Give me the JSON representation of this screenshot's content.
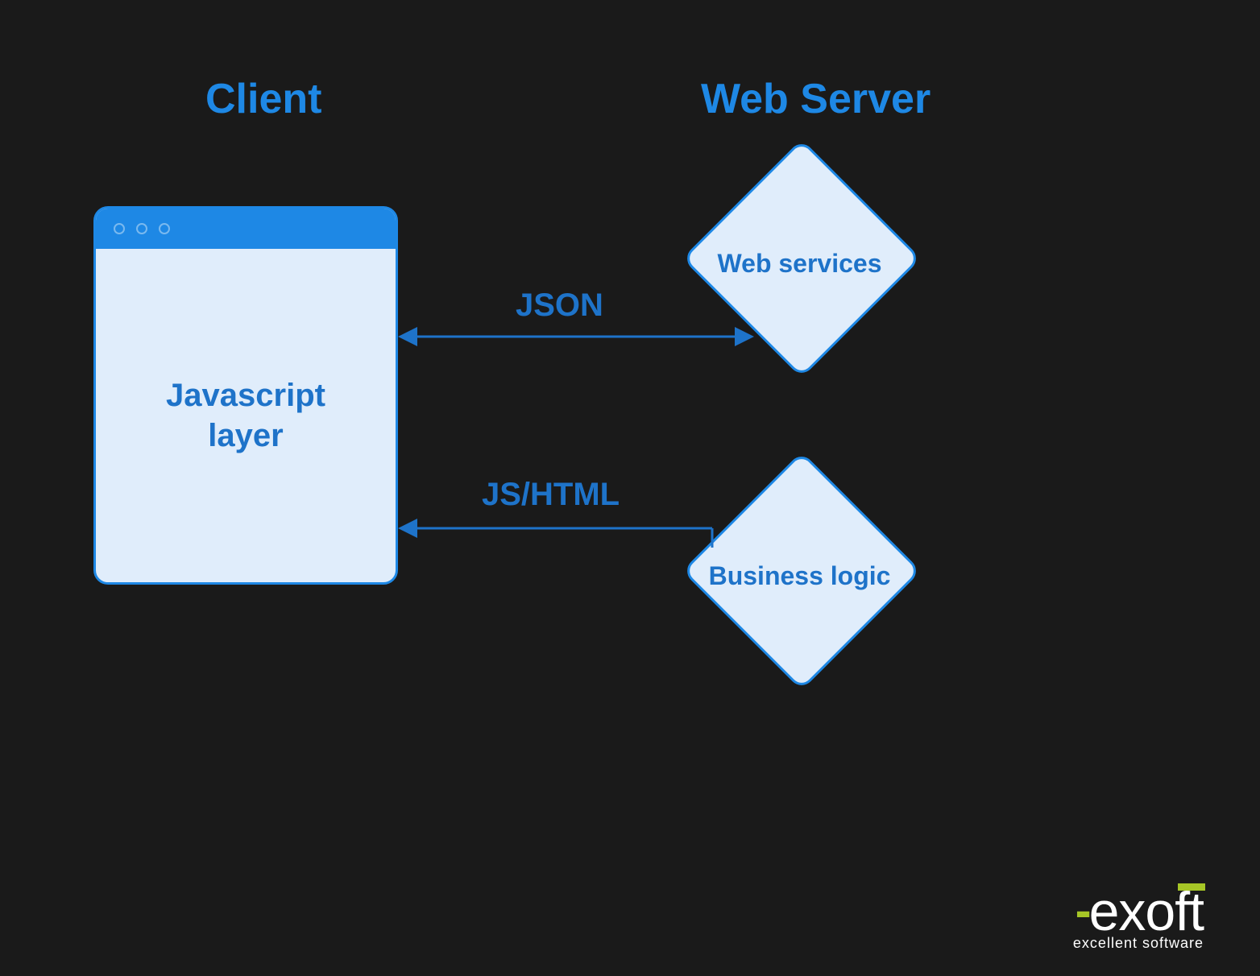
{
  "titles": {
    "client": "Client",
    "server": "Web Server"
  },
  "browser": {
    "label_line1": "Javascript",
    "label_line2": "layer"
  },
  "nodes": {
    "web_services": "Web services",
    "business_logic": "Business logic"
  },
  "arrows": {
    "json": "JSON",
    "jshtml": "JS/HTML"
  },
  "logo": {
    "brand": "exoft",
    "tagline": "excellent software"
  },
  "colors": {
    "bg": "#1a1a1a",
    "primary": "#1e88e5",
    "text": "#1e73c9",
    "fill": "#e0edfb",
    "accent": "#a6c626"
  }
}
